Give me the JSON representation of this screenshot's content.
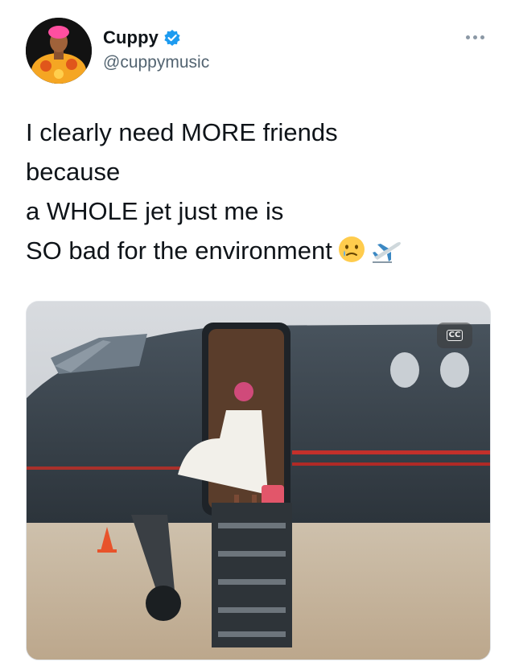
{
  "tweet": {
    "display_name": "Cuppy",
    "handle": "@cuppymusic",
    "verified": true,
    "text_lines": [
      "I clearly need MORE friends",
      "because",
      "a WHOLE jet just me is",
      "SO bad for the environment"
    ],
    "emojis": [
      "crying-face-emoji",
      "airplane-departure-emoji"
    ],
    "media": {
      "type": "video",
      "captions_button": "CC"
    }
  },
  "colors": {
    "verified_blue": "#1d9bf0",
    "text": "#0f1419",
    "secondary_text": "#536471",
    "avatar_bg": "#111111",
    "avatar_accent": "#f5a623"
  }
}
